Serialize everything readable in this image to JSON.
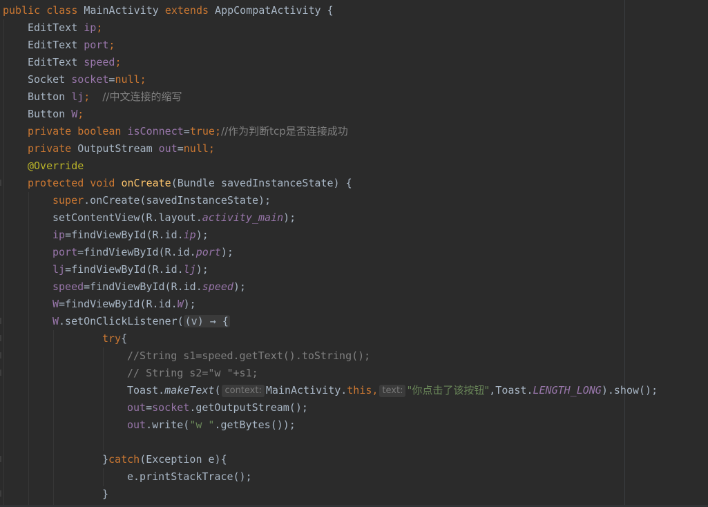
{
  "editor": {
    "language": "java",
    "theme_colors": {
      "background": "#2b2b2b",
      "text": "#a9b7c6",
      "keyword": "#cc7832",
      "field": "#9876aa",
      "annotation": "#bbb529",
      "method_declaration": "#ffc66d",
      "string": "#6a8759",
      "comment": "#808080"
    },
    "lines": {
      "l1": {
        "kw1": "public class",
        "cls": " MainActivity ",
        "kw2": "extends",
        "rest": " AppCompatActivity {"
      },
      "l2": {
        "type": "EditText ",
        "name": "ip",
        "end": ";"
      },
      "l3": {
        "type": "EditText ",
        "name": "port",
        "end": ";"
      },
      "l4": {
        "type": "EditText ",
        "name": "speed",
        "end": ";"
      },
      "l5": {
        "type": "Socket ",
        "name": "socket",
        "eq": "=",
        "val": "null",
        "end": ";"
      },
      "l6": {
        "type": "Button ",
        "name": "lj",
        "end": ";",
        "comment": "//中文连接的缩写"
      },
      "l7": {
        "type": "Button ",
        "name": "W",
        "end": ";"
      },
      "l8": {
        "kw": "private boolean ",
        "name": "isConnect",
        "eq": "=",
        "val": "true",
        "end": ";",
        "comment": "//作为判断tcp是否连接成功"
      },
      "l9": {
        "kw": "private ",
        "type": "OutputStream ",
        "name": "out",
        "eq": "=",
        "val": "null",
        "end": ";"
      },
      "l10": {
        "annotation": "@Override"
      },
      "l11": {
        "kw": "protected void ",
        "fn": "onCreate",
        "rest": "(Bundle savedInstanceState) {"
      },
      "l12": {
        "kw": "super",
        "rest": ".onCreate(savedInstanceState);"
      },
      "l13": {
        "pre": "setContentView(R.layout.",
        "field": "activity_main",
        "post": ");"
      },
      "l14": {
        "name": "ip",
        "pre": "=findViewById(R.id.",
        "field": "ip",
        "post": ");"
      },
      "l15": {
        "name": "port",
        "pre": "=findViewById(R.id.",
        "field": "port",
        "post": ");"
      },
      "l16": {
        "name": "lj",
        "pre": "=findViewById(R.id.",
        "field": "lj",
        "post": ");"
      },
      "l17": {
        "name": "speed",
        "pre": "=findViewById(R.id.",
        "field": "speed",
        "post": ");"
      },
      "l18": {
        "name": "W",
        "pre": "=findViewById(R.id.",
        "field": "W",
        "post": ");"
      },
      "l19": {
        "name": "W",
        "pre": ".setOnClickListener(",
        "lambda": "(v) → {"
      },
      "l20": {
        "kw": "try",
        "rest": "{"
      },
      "l21": {
        "comment": "//String s1=speed.getText().toString();"
      },
      "l22": {
        "comment_a": "// String s2=\"w \"+s1;"
      },
      "l23": {
        "pre": "Toast.",
        "method": "makeText",
        "paren": "(",
        "hint1": "context:",
        "arg1": "MainActivity.",
        "kw": "this",
        "comma": ",",
        "hint2": "text:",
        "str": "\"你点击了该按钮\"",
        "mid": ",Toast.",
        "const": "LENGTH_LONG",
        "post": ").show();"
      },
      "l24": {
        "name": "out",
        "eq": "=",
        "name2": "socket",
        "post": ".getOutputStream();"
      },
      "l25": {
        "name": "out",
        "pre": ".write(",
        "str": "\"w \"",
        "post": ".getBytes());"
      },
      "l27": {
        "pre": "}",
        "kw": "catch",
        "post": "(Exception e){"
      },
      "l28": {
        "text": "e.printStackTrace();"
      },
      "l29": {
        "text": "}"
      }
    }
  }
}
